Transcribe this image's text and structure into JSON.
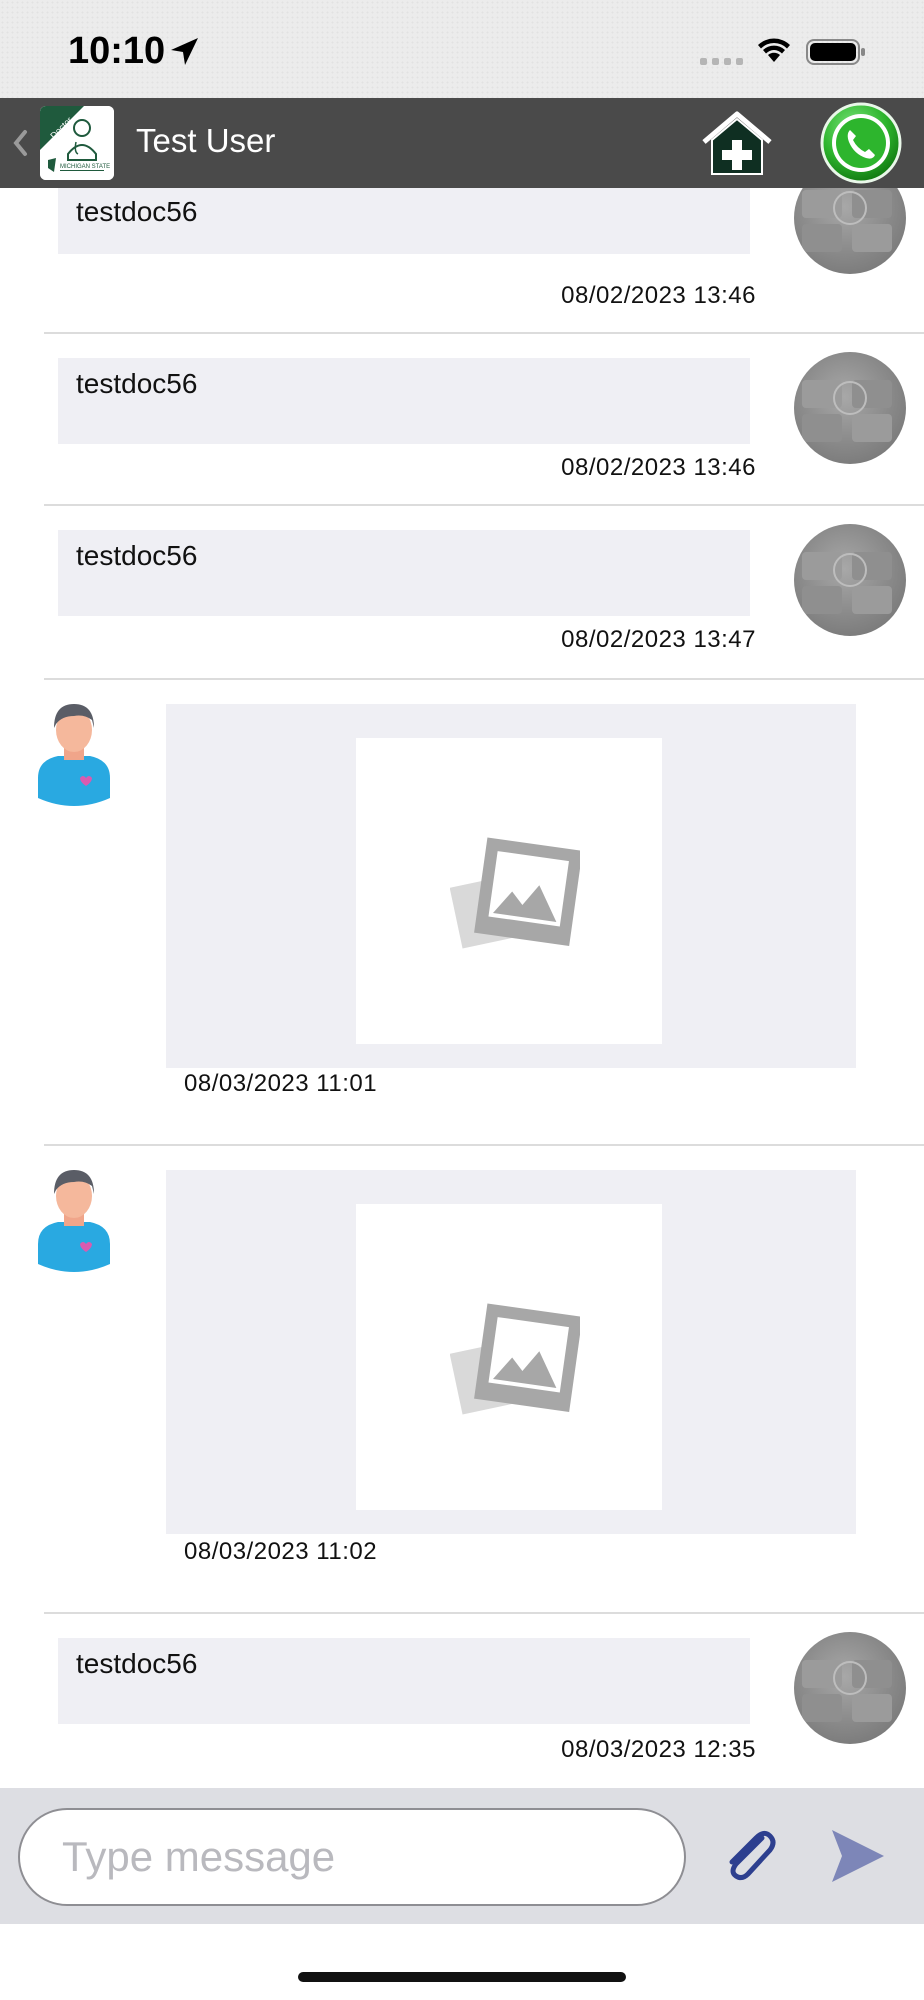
{
  "status_bar": {
    "time": "10:10"
  },
  "nav": {
    "title": "Test User",
    "logo_badge": "Doctor",
    "logo_caption": "MICHIGAN STATE"
  },
  "messages": [
    {
      "type": "text",
      "sender": "doctor",
      "text": "testdoc56",
      "time": "08/02/2023 13:46"
    },
    {
      "type": "text",
      "sender": "doctor",
      "text": "testdoc56",
      "time": "08/02/2023 13:46"
    },
    {
      "type": "text",
      "sender": "doctor",
      "text": "testdoc56",
      "time": "08/02/2023 13:47"
    },
    {
      "type": "image",
      "sender": "user",
      "time": "08/03/2023 11:01"
    },
    {
      "type": "image",
      "sender": "user",
      "time": "08/03/2023 11:02"
    },
    {
      "type": "text",
      "sender": "doctor",
      "text": "testdoc56",
      "time": "08/03/2023 12:35"
    }
  ],
  "composer": {
    "placeholder": "Type message"
  },
  "colors": {
    "nav_bg": "#4a4a4a",
    "bubble_bg": "#efeff4",
    "input_bar_bg": "#dddee3",
    "send_accent": "#7d86b8",
    "attach_accent": "#2d3f8f",
    "call_green": "#2db52d"
  },
  "icons": [
    "location-arrow-icon",
    "signal-icon",
    "wifi-icon",
    "battery-icon",
    "back-chevron-icon",
    "home-medical-icon",
    "phone-call-icon",
    "paperclip-icon",
    "send-icon",
    "image-placeholder-icon"
  ]
}
